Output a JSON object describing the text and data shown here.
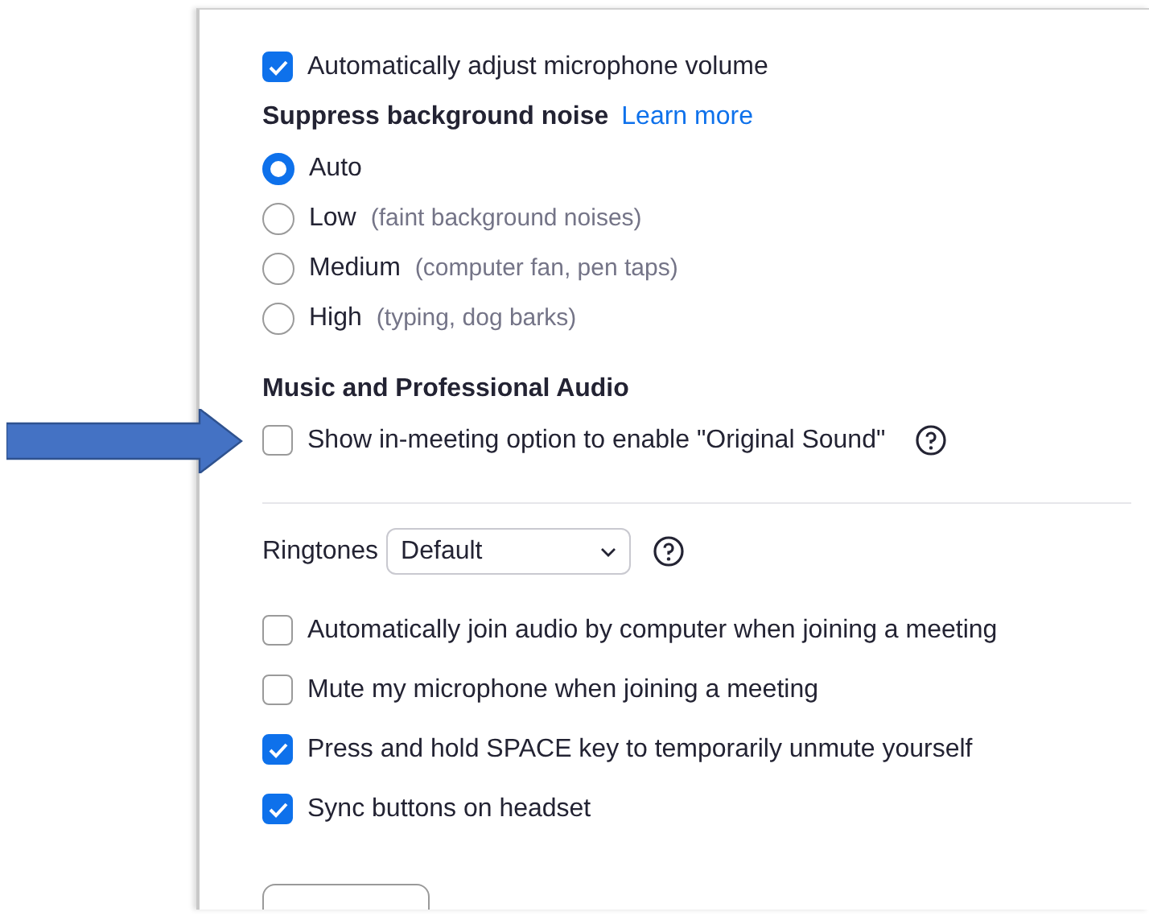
{
  "auto_adjust": {
    "label": "Automatically adjust microphone volume",
    "checked": true
  },
  "noise": {
    "heading": "Suppress background noise",
    "link": "Learn more",
    "options": [
      {
        "label": "Auto",
        "selected": true
      },
      {
        "label": "Low",
        "hint": "(faint background noises)",
        "selected": false
      },
      {
        "label": "Medium",
        "hint": "(computer fan, pen taps)",
        "selected": false
      },
      {
        "label": "High",
        "hint": "(typing, dog barks)",
        "selected": false
      }
    ]
  },
  "music": {
    "heading": "Music and Professional Audio",
    "original_sound": {
      "label": "Show in-meeting option to enable \"Original Sound\"",
      "checked": false
    }
  },
  "ringtones": {
    "label": "Ringtones",
    "value": "Default"
  },
  "options": [
    {
      "label": "Automatically join audio by computer when joining a meeting",
      "checked": false
    },
    {
      "label": "Mute my microphone when joining a meeting",
      "checked": false
    },
    {
      "label": "Press and hold SPACE key to temporarily unmute yourself",
      "checked": true
    },
    {
      "label": "Sync buttons on headset",
      "checked": true
    }
  ]
}
